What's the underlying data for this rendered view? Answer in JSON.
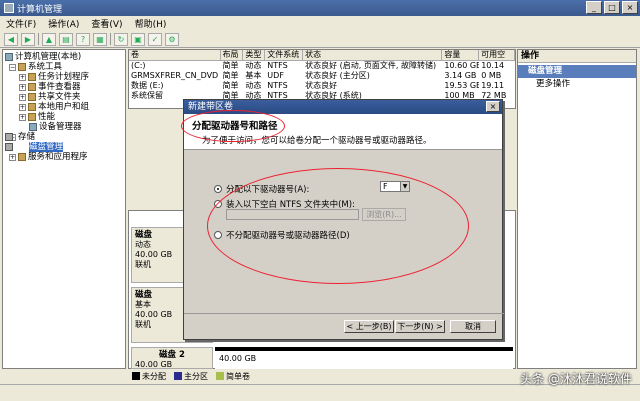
{
  "window": {
    "title": "计算机管理",
    "min": "_",
    "max": "□",
    "close": "×"
  },
  "menu": [
    "文件(F)",
    "操作(A)",
    "查看(V)",
    "帮助(H)"
  ],
  "tree": {
    "root": "计算机管理(本地)",
    "system_tools": "系统工具",
    "task_scheduler": "任务计划程序",
    "event_viewer": "事件查看器",
    "shared_folders": "共享文件夹",
    "local_users": "本地用户和组",
    "performance": "性能",
    "device_manager": "设备管理器",
    "storage": "存储",
    "disk_management": "磁盘管理",
    "services": "服务和应用程序"
  },
  "list": {
    "headers": [
      "卷",
      "布局",
      "类型",
      "文件系统",
      "状态",
      "容量",
      "可用空"
    ],
    "rows": [
      [
        "(C:)",
        "简单",
        "动态",
        "NTFS",
        "状态良好 (启动, 页面文件, 故障转储)",
        "10.60 GB",
        "10.14"
      ],
      [
        "GRMSXFRER_CN_DVD (D:)",
        "简单",
        "基本",
        "UDF",
        "状态良好 (主分区)",
        "3.14 GB",
        "0 MB"
      ],
      [
        "数据 (E:)",
        "简单",
        "动态",
        "NTFS",
        "状态良好",
        "19.53 GB",
        "19.11"
      ],
      [
        "系统保留",
        "简单",
        "动态",
        "NTFS",
        "状态良好 (系统)",
        "100 MB",
        "72 MB"
      ]
    ]
  },
  "disks": [
    {
      "name": "磁盘",
      "type": "动态",
      "size": "40.00 GB",
      "status": "联机"
    },
    {
      "name": "磁盘",
      "type": "基本",
      "size": "40.00 GB",
      "status": "联机"
    },
    {
      "name": "磁盘 2",
      "type": "",
      "size": "40.00 GB",
      "status": ""
    }
  ],
  "lower_partition_size": "40.00 GB",
  "legend": [
    "未分配",
    "主分区",
    "简单卷"
  ],
  "legend_colors": [
    "#000000",
    "#2b2b8f",
    "#a8c04a"
  ],
  "actions": {
    "header": "操作",
    "section": "磁盘管理",
    "more": "更多操作"
  },
  "dialog": {
    "title": "新建带区卷",
    "heading": "分配驱动器号和路径",
    "subheading": "为了便于访问，您可以给卷分配一个驱动器号或驱动器路径。",
    "opt_assign": "分配以下驱动器号(A):",
    "drive_letter": "F",
    "opt_mount": "装入以下空白 NTFS 文件夹中(M):",
    "browse": "浏览(R)...",
    "opt_none": "不分配驱动器号或驱动器路径(D)",
    "back": "< 上一步(B)",
    "next": "下一步(N) >",
    "cancel": "取消"
  },
  "watermark": "头条 @沐沐君说软件"
}
